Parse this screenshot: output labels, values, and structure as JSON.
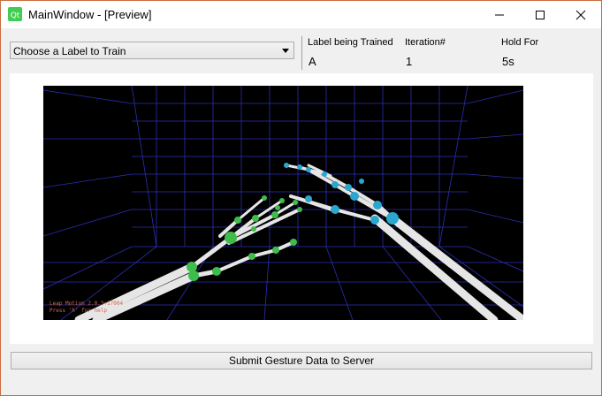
{
  "window": {
    "title": "MainWindow - [Preview]"
  },
  "controls": {
    "label_select": {
      "value": "Choose a Label to Train"
    },
    "label_header": "Label being Trained",
    "iteration_header": "Iteration#",
    "hold_header": "Hold For",
    "label_value": "A",
    "iteration_value": "1",
    "hold_value": "5s"
  },
  "viewport": {
    "overlay_line1": "Leap Motion 2.0.3+17004",
    "overlay_line2": "Press 'h' for help"
  },
  "submit_label": "Submit Gesture Data to Server",
  "colors": {
    "accent_border": "#c96b3f",
    "grid": "#2b2fb5",
    "joint_left": "#3fbd4a",
    "joint_right": "#2aa7cf",
    "bone": "#e6e6e6"
  }
}
